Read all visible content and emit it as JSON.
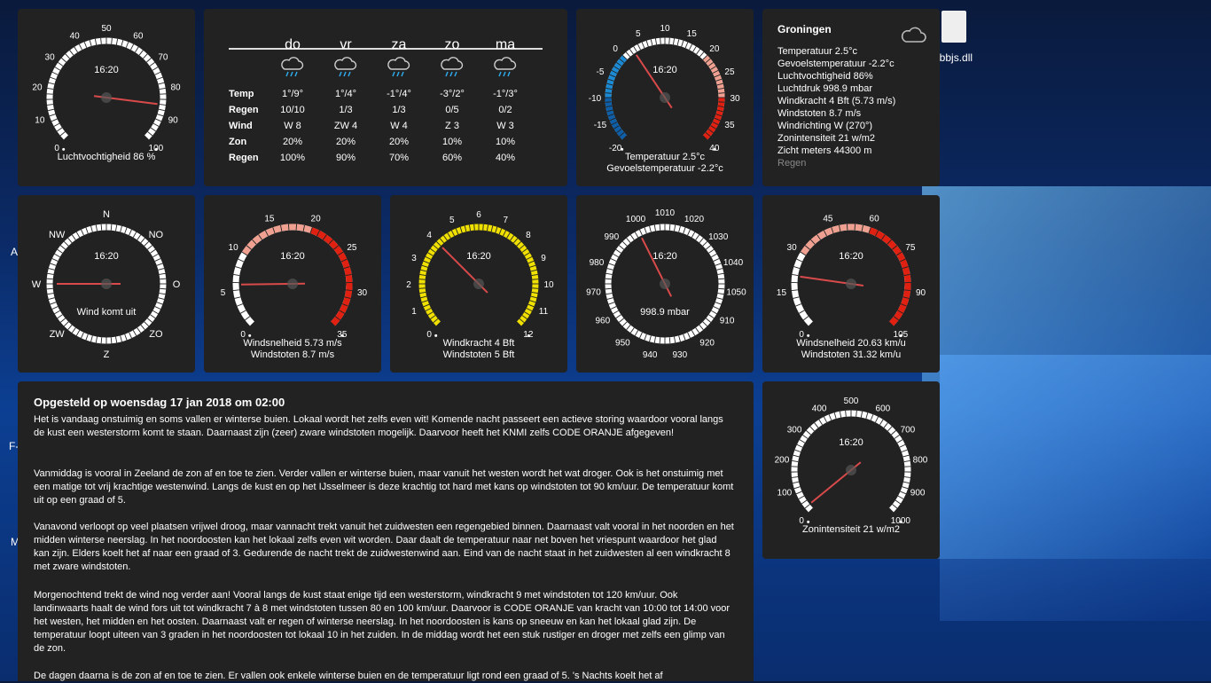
{
  "desktop": {
    "file_label": "obbjs.dll",
    "left_labels": [
      "A",
      "F-",
      "M"
    ]
  },
  "humidity": {
    "time": "16:20",
    "caption": "Luchtvochtigheid 86 %",
    "value": 86,
    "ticks": [
      "0",
      "10",
      "20",
      "30",
      "40",
      "50",
      "60",
      "70",
      "80",
      "90",
      "100"
    ]
  },
  "forecast": {
    "days": [
      "do",
      "vr",
      "za",
      "zo",
      "ma"
    ],
    "row_labels": [
      "Temp",
      "Regen",
      "Wind",
      "Zon",
      "Regen"
    ],
    "rows": [
      [
        "1°/9°",
        "1°/4°",
        "-1°/4°",
        "-3°/2°",
        "-1°/3°"
      ],
      [
        "10/10",
        "1/3",
        "1/3",
        "0/5",
        "0/2"
      ],
      [
        "W 8",
        "ZW 4",
        "W 4",
        "Z 3",
        "W 3"
      ],
      [
        "20%",
        "20%",
        "20%",
        "10%",
        "10%"
      ],
      [
        "100%",
        "90%",
        "70%",
        "60%",
        "40%"
      ]
    ],
    "icon": "rain-snow-icon"
  },
  "temperature": {
    "time": "16:20",
    "caption1": "Temperatuur 2.5°c",
    "caption2": "Gevoelstemperatuur -2.2°c",
    "value": 2.5,
    "ticks": [
      "-20",
      "-15",
      "-10",
      "-5",
      "0",
      "5",
      "10",
      "15",
      "20",
      "25",
      "30",
      "35",
      "40"
    ]
  },
  "station": {
    "city": "Groningen",
    "lines": [
      "Temperatuur 2.5°c",
      "Gevoelstemperatuur -2.2°c",
      "Luchtvochtigheid 86%",
      "Luchtdruk 998.9 mbar",
      "Windkracht 4 Bft (5.73 m/s)",
      "Windstoten 8.7 m/s",
      "Windrichting W (270°)",
      "Zonintensiteit 21 w/m2",
      "Zicht meters 44300 m"
    ],
    "condition": "Regen",
    "icon": "cloud-icon"
  },
  "compass": {
    "time": "16:20",
    "caption": "Wind komt uit",
    "direction_deg": 270,
    "labels": [
      "N",
      "NO",
      "O",
      "ZO",
      "Z",
      "ZW",
      "W",
      "NW"
    ]
  },
  "windspeed_ms": {
    "time": "16:20",
    "caption1": "Windsnelheid 5.73 m/s",
    "caption2": "Windstoten 8.7 m/s",
    "value": 5.73,
    "ticks": [
      "0",
      "5",
      "10",
      "15",
      "20",
      "25",
      "30",
      "35"
    ]
  },
  "beaufort": {
    "time": "16:20",
    "caption1": "Windkracht 4 Bft",
    "caption2": "Windstoten 5 Bft",
    "value": 4,
    "ticks": [
      "0",
      "1",
      "2",
      "3",
      "4",
      "5",
      "6",
      "7",
      "8",
      "9",
      "10",
      "11",
      "12"
    ]
  },
  "pressure": {
    "time": "16:20",
    "readout": "998.9 mbar",
    "value": 998.9,
    "ticks": [
      "940",
      "950",
      "960",
      "970",
      "980",
      "990",
      "1000",
      "1010",
      "1020",
      "1030",
      "1040",
      "1050",
      "910",
      "920",
      "930"
    ]
  },
  "windspeed_kmh": {
    "time": "16:20",
    "caption1": "Windsnelheid 20.63 km/u",
    "caption2": "Windstoten 31.32 km/u",
    "value": 20.63,
    "ticks": [
      "0",
      "15",
      "30",
      "45",
      "60",
      "75",
      "90",
      "105"
    ]
  },
  "sun": {
    "time": "16:20",
    "caption": "Zonintensiteit 21 w/m2",
    "value": 21,
    "ticks": [
      "0",
      "100",
      "200",
      "300",
      "400",
      "500",
      "600",
      "700",
      "800",
      "900",
      "1000"
    ]
  },
  "report": {
    "title": "Opgesteld op woensdag 17 jan 2018 om 02:00",
    "paragraphs": [
      "Het is vandaag onstuimig en soms vallen er winterse buien. Lokaal wordt het zelfs even wit! Komende nacht passeert een actieve storing waardoor vooral langs de kust een westerstorm komt te staan. Daarnaast zijn (zeer) zware windstoten mogelijk. Daarvoor heeft het KNMI zelfs CODE ORANJE afgegeven!",
      "Vanmiddag is vooral in Zeeland de zon af en toe te zien. Verder vallen er winterse buien, maar vanuit het westen wordt het wat droger. Ook is het onstuimig met een matige tot vrij krachtige westenwind. Langs de kust en op het IJsselmeer is deze krachtig tot hard met kans op windstoten tot 90 km/uur. De temperatuur komt uit op een graad of 5.",
      "Vanavond verloopt op veel plaatsen vrijwel droog, maar vannacht trekt vanuit het zuidwesten een regengebied binnen. Daarnaast valt vooral in het noorden en het midden winterse neerslag. In het noordoosten kan het lokaal zelfs even wit worden. Daar daalt de temperatuur naar net boven het vriespunt waardoor het glad kan zijn. Elders koelt het af naar een graad of 3. Gedurende de nacht trekt de zuidwestenwind aan. Eind van de nacht staat in het zuidwesten al een windkracht 8 met zware windstoten.",
      "Morgenochtend trekt de wind nog verder aan! Vooral langs de kust staat enige tijd een westerstorm, windkracht 9 met windstoten tot 120 km/uur. Ook landinwaarts haalt de wind fors uit tot windkracht 7 à 8 met windstoten tussen 80 en 100 km/uur. Daarvoor is CODE ORANJE van kracht van 10:00 tot 14:00 voor het westen, het midden en het oosten. Daarnaast valt er regen of winterse neerslag. In het noordoosten is kans op sneeuw en kan het lokaal glad zijn. De temperatuur loopt uiteen van 3 graden in het noordoosten tot lokaal 10 in het zuiden. In de middag wordt het een stuk rustiger en droger met zelfs een glimp van de zon.",
      "De dagen daarna is de zon af en toe te zien. Er vallen ook enkele winterse buien en de temperatuur ligt rond een graad of 5. 's Nachts koelt het af"
    ]
  },
  "colors": {
    "panel": "#222222",
    "needle": "#d94a4a",
    "hot": "#e02010",
    "cold": "#1a8ad4",
    "yellow": "#f0e000"
  }
}
